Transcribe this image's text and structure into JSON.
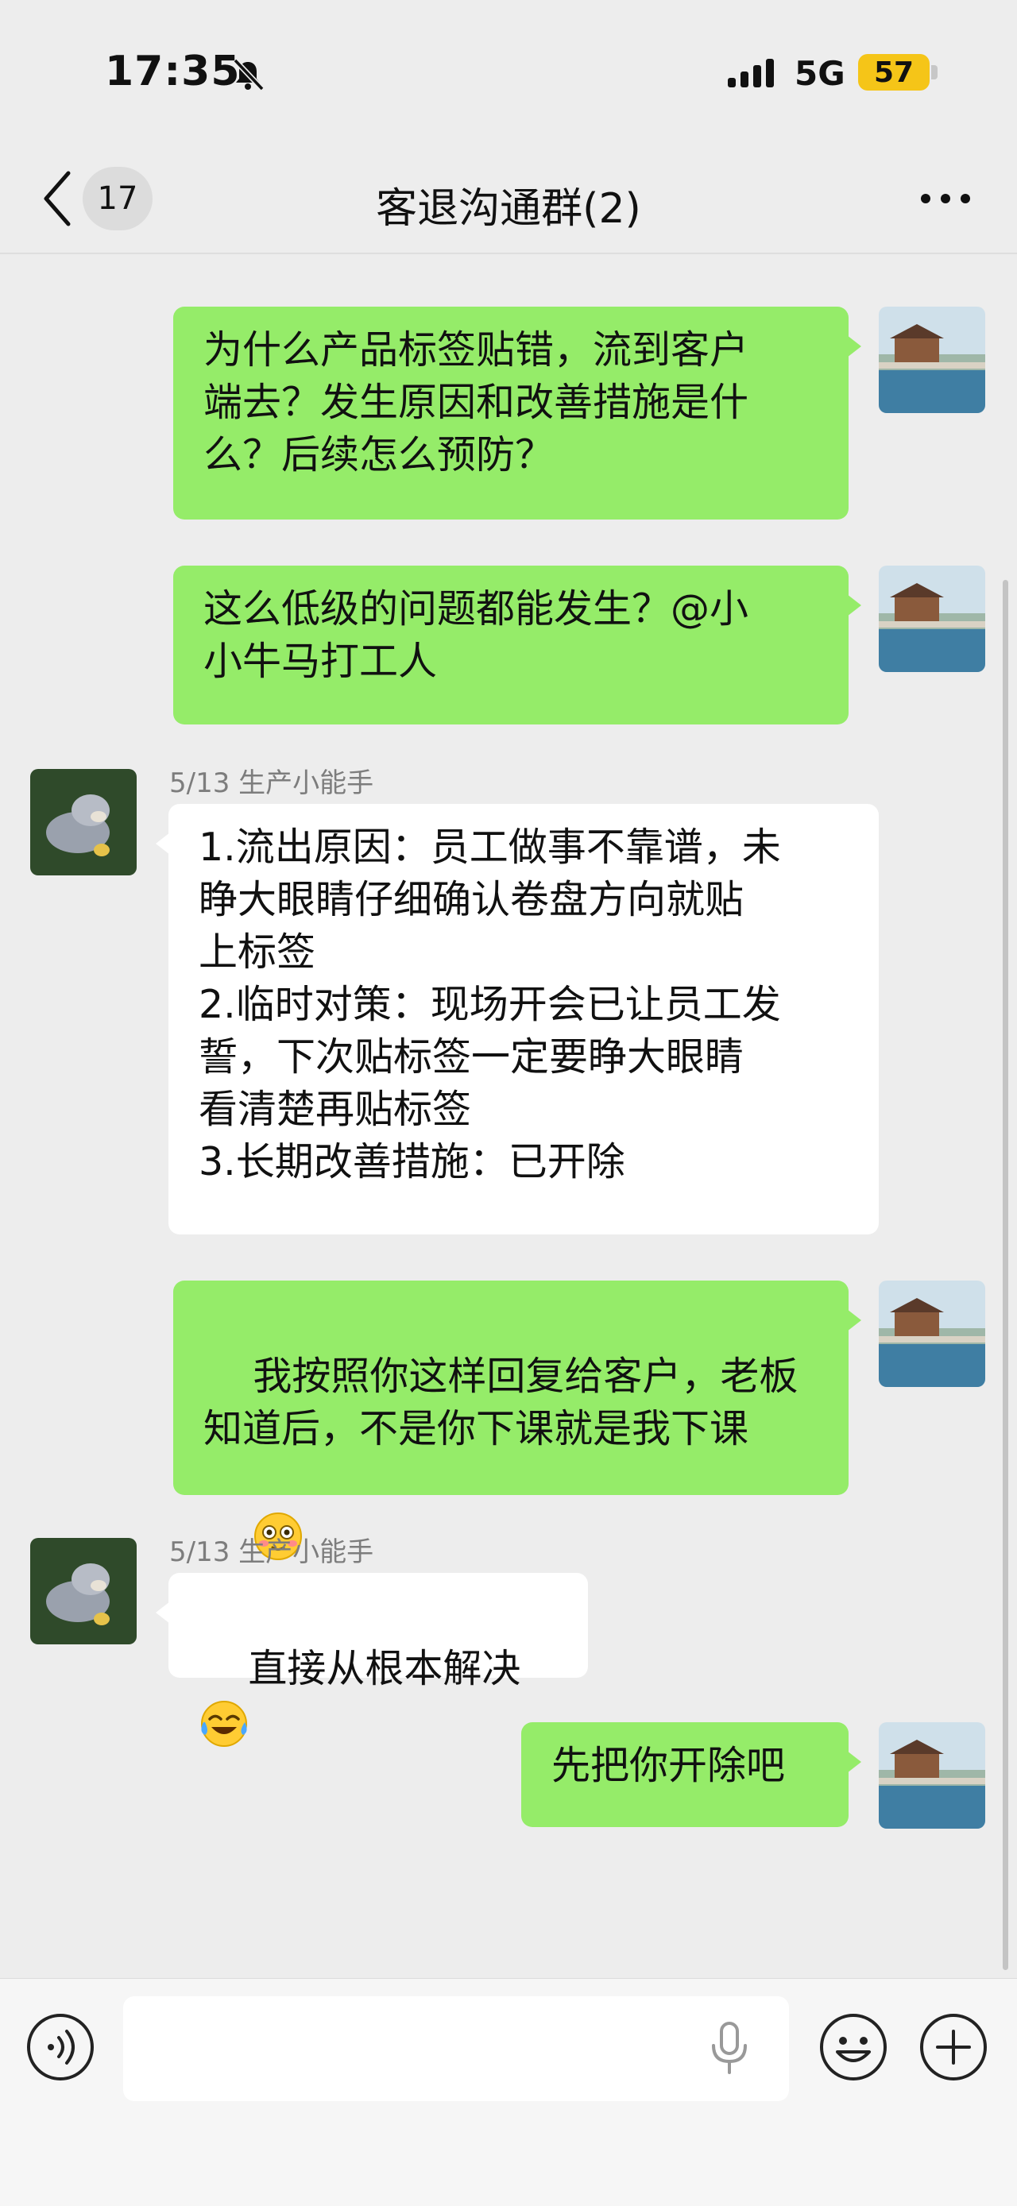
{
  "status_bar": {
    "time": "17:35",
    "network": "5G",
    "battery": "57"
  },
  "nav": {
    "back_count": "17",
    "title": "客退沟通群(2)"
  },
  "messages": [
    {
      "side": "me",
      "text": "为什么产品标签贴错，流到客户\n端去？发生原因和改善措施是什\n么？后续怎么预防？"
    },
    {
      "side": "me",
      "text": "这么低级的问题都能发生？@小\n小牛马打工人"
    },
    {
      "side": "other",
      "sender": "5/13 生产小能手",
      "text": "1.流出原因：员工做事不靠谱，未\n睁大眼睛仔细确认卷盘方向就贴\n上标签\n2.临时对策：现场开会已让员工发\n誓，下次贴标签一定要睁大眼睛\n看清楚再贴标签\n3.长期改善措施：已开除"
    },
    {
      "side": "me",
      "text": "我按照你这样回复给客户，老板\n知道后，不是你下课就是我下课",
      "emoji": "flushed-face"
    },
    {
      "side": "other",
      "sender": "5/13 生产小能手",
      "text": "直接从根本解决",
      "emoji": "tears-of-joy"
    },
    {
      "side": "me",
      "text": "先把你开除吧"
    }
  ],
  "input": {
    "value": "",
    "placeholder": ""
  },
  "icons": {
    "back": "chevron-left-icon",
    "more": "more-dots-icon",
    "voice": "voice-icon",
    "mic": "microphone-icon",
    "emoji": "emoji-icon",
    "plus": "plus-icon"
  },
  "colors": {
    "my_bubble": "#95ec69",
    "other_bubble": "#ffffff",
    "background": "#ededed",
    "battery": "#f5c518"
  }
}
